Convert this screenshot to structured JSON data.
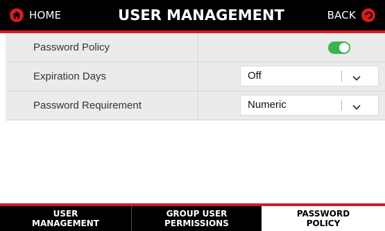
{
  "header": {
    "home_label": "HOME",
    "title": "USER MANAGEMENT",
    "back_label": "BACK",
    "home_icon": "home-icon",
    "back_icon": "back-arrow-icon"
  },
  "settings": [
    {
      "label": "Password Policy",
      "control": "toggle",
      "enabled": true
    },
    {
      "label": "Expiration Days",
      "control": "select",
      "value": "Off"
    },
    {
      "label": "Password Requirement",
      "control": "select",
      "value": "Numeric"
    }
  ],
  "tabs": [
    {
      "label": "USER\nMANAGEMENT",
      "active": false
    },
    {
      "label": "GROUP USER\nPERMISSIONS",
      "active": false
    },
    {
      "label": "PASSWORD\nPOLICY",
      "active": true
    }
  ],
  "colors": {
    "accent": "#d71920",
    "toggle_on": "#3ab54a",
    "header_bg": "#000000",
    "row_bg": "#ebebeb"
  }
}
